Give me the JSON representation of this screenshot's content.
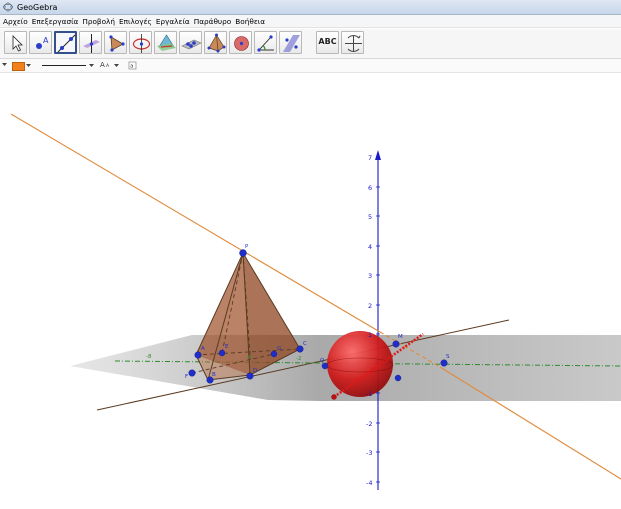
{
  "window": {
    "title": "GeoGebra"
  },
  "menu": [
    "Αρχείο",
    "Επεξεργασία",
    "Προβολή",
    "Επιλογές",
    "Εργαλεία",
    "Παράθυρο",
    "Βοήθεια"
  ],
  "toolbar": {
    "selected_index": 2,
    "tools": [
      {
        "name": "move-tool",
        "icon": "arrow-cursor-icon"
      },
      {
        "name": "point-tool",
        "icon": "point-icon",
        "label": "A"
      },
      {
        "name": "line-tool",
        "icon": "line-through-points-icon"
      },
      {
        "name": "perpendicular-line-tool",
        "icon": "perpendicular-line-icon"
      },
      {
        "name": "polygon-tool",
        "icon": "polygon-icon"
      },
      {
        "name": "circle-axis-tool",
        "icon": "circle-axis-icon"
      },
      {
        "name": "intersect-surfaces-tool",
        "icon": "intersect-surfaces-icon"
      },
      {
        "name": "plane-tool",
        "icon": "plane-through-points-icon"
      },
      {
        "name": "pyramid-tool",
        "icon": "pyramid-icon"
      },
      {
        "name": "sphere-tool",
        "icon": "sphere-icon"
      },
      {
        "name": "angle-tool",
        "icon": "angle-icon"
      },
      {
        "name": "reflect-tool",
        "icon": "reflect-plane-icon"
      },
      {
        "name": "text-tool",
        "icon": "text-icon",
        "label": "ABC"
      },
      {
        "name": "rotate-view-tool",
        "icon": "rotate-view-icon"
      }
    ]
  },
  "stylebar": {
    "color": "#f0811d",
    "text_size_label": "A"
  },
  "view3d": {
    "z_axis_ticks": [
      "7",
      "6",
      "5",
      "4",
      "3",
      "2",
      "1",
      "-1",
      "-2",
      "-3",
      "-4"
    ],
    "x_axis_ticks": [
      "-8",
      "-6",
      "-4",
      "-2"
    ],
    "point_labels": {
      "apex": "P",
      "base_a": "A",
      "base_b": "B",
      "base_c": "C",
      "base_d": "D",
      "base_e": "E",
      "m": "M",
      "g": "G",
      "q": "Q",
      "s": "S",
      "f": "F"
    },
    "colors": {
      "pyramid": "#a0522d",
      "sphere": "#cc1111",
      "line": "#e08a3a",
      "axis_z": "#1a1ac8",
      "axis_y": "#2e8b2e",
      "points": "#1f2ec8"
    }
  }
}
